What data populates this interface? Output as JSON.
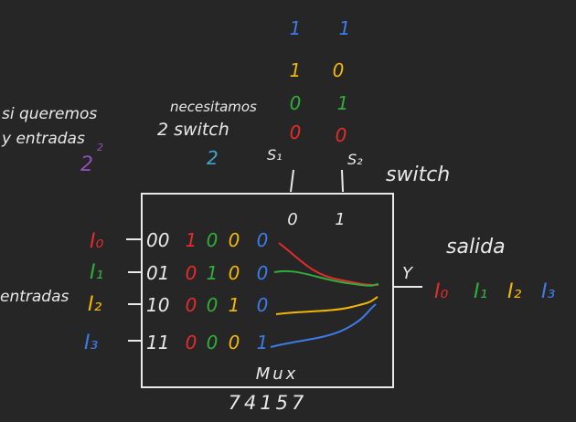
{
  "colors": {
    "background": "#262626",
    "ink": "#e9e9e9",
    "red": "#e52b2b",
    "green": "#2fae3a",
    "yellow": "#f2b705",
    "blue": "#3d7be8",
    "purple": "#8e4fb8",
    "cyan": "#3fa5c8"
  },
  "notes": {
    "si_queremos_line1": "si queremos",
    "si_queremos_line2": "y entradas",
    "two_pow_base": "2",
    "two_pow_exp": "2",
    "necesitamos_line1": "necesitamos",
    "necesitamos_line2": "2 switch",
    "two": "2"
  },
  "switches": {
    "s1_label": "S₁",
    "s2_label": "S₂",
    "switch_label": "switch",
    "col_s1": [
      "1",
      "1",
      "0",
      "0"
    ],
    "col_s2": [
      "1",
      "0",
      "1",
      "0"
    ],
    "header_0": "0",
    "header_1": "1"
  },
  "inputs": {
    "entradas_label": "entradas",
    "rows": [
      {
        "name": "I₀",
        "code": "00",
        "bits": [
          "1",
          "0",
          "0",
          "0"
        ]
      },
      {
        "name": "I₁",
        "code": "01",
        "bits": [
          "0",
          "1",
          "0",
          "0"
        ]
      },
      {
        "name": "I₂",
        "code": "10",
        "bits": [
          "0",
          "0",
          "1",
          "0"
        ]
      },
      {
        "name": "I₃",
        "code": "11",
        "bits": [
          "0",
          "0",
          "0",
          "1"
        ]
      }
    ]
  },
  "mux": {
    "label": "Mux",
    "chip": "74157"
  },
  "output": {
    "y_label": "Y",
    "salida_label": "salida",
    "values": [
      "I₀",
      "I₁",
      "I₂",
      "I₃"
    ]
  }
}
